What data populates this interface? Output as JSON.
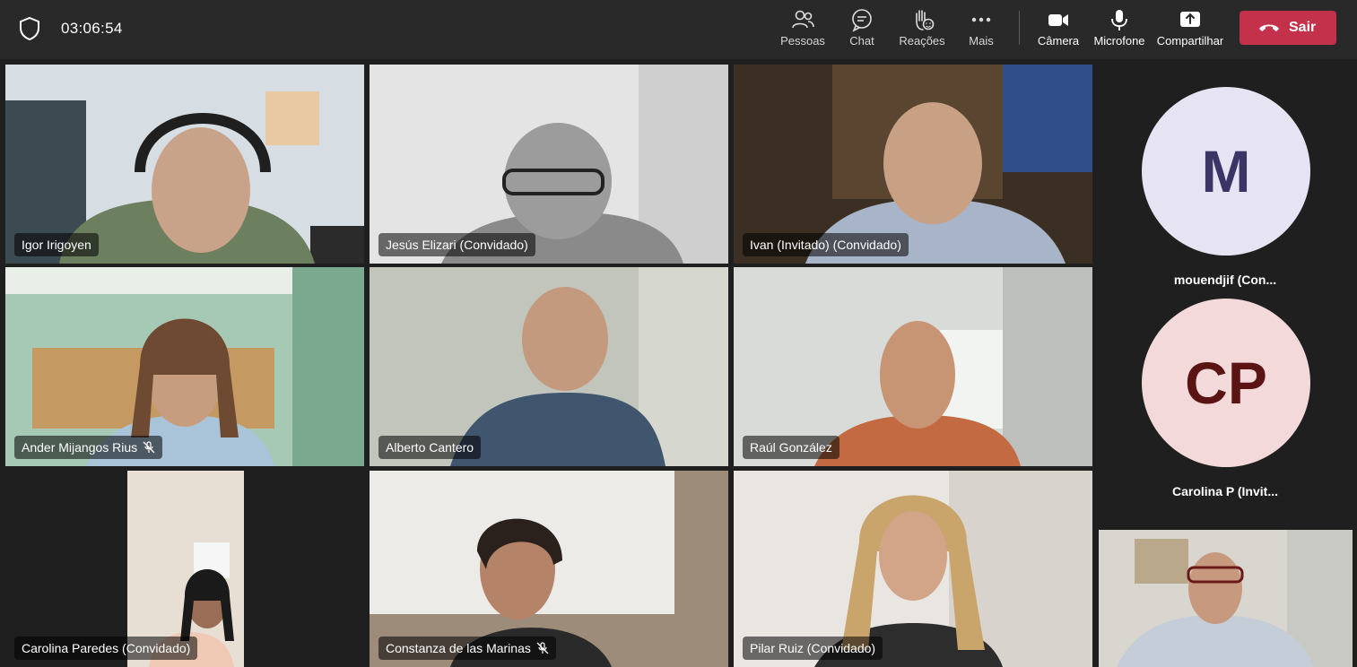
{
  "call": {
    "timer": "03:06:54"
  },
  "toolbar": {
    "people": "Pessoas",
    "chat": "Chat",
    "reactions": "Reações",
    "more": "Mais",
    "camera": "Câmera",
    "microphone": "Microfone",
    "share": "Compartilhar",
    "leave": "Sair"
  },
  "participants": [
    {
      "name": "Igor Irigoyen",
      "muted": false,
      "speaking": false
    },
    {
      "name": "Jesús Elizari (Convidado)",
      "muted": false,
      "speaking": true
    },
    {
      "name": "Ivan (Invitado) (Convidado)",
      "muted": false,
      "speaking": false
    },
    {
      "name": "Ander Mijangos Rius",
      "muted": true,
      "speaking": false
    },
    {
      "name": "Alberto Cantero",
      "muted": false,
      "speaking": false
    },
    {
      "name": "Raúl González",
      "muted": false,
      "speaking": false
    },
    {
      "name": "Carolina Paredes (Convidado)",
      "muted": false,
      "speaking": false
    },
    {
      "name": "Constanza de las Marinas",
      "muted": true,
      "speaking": false
    },
    {
      "name": "Pilar Ruiz (Convidado)",
      "muted": false,
      "speaking": true
    }
  ],
  "rail": [
    {
      "initials": "M",
      "name": "mouendjif (Con...",
      "bg": "#e6e3f2",
      "fg": "#3b3566"
    },
    {
      "initials": "CP",
      "name": "Carolina P (Invit...",
      "bg": "#f3d9d9",
      "fg": "#5a1414"
    }
  ],
  "colors": {
    "accent": "#7f85f5",
    "leave": "#c4314b"
  }
}
